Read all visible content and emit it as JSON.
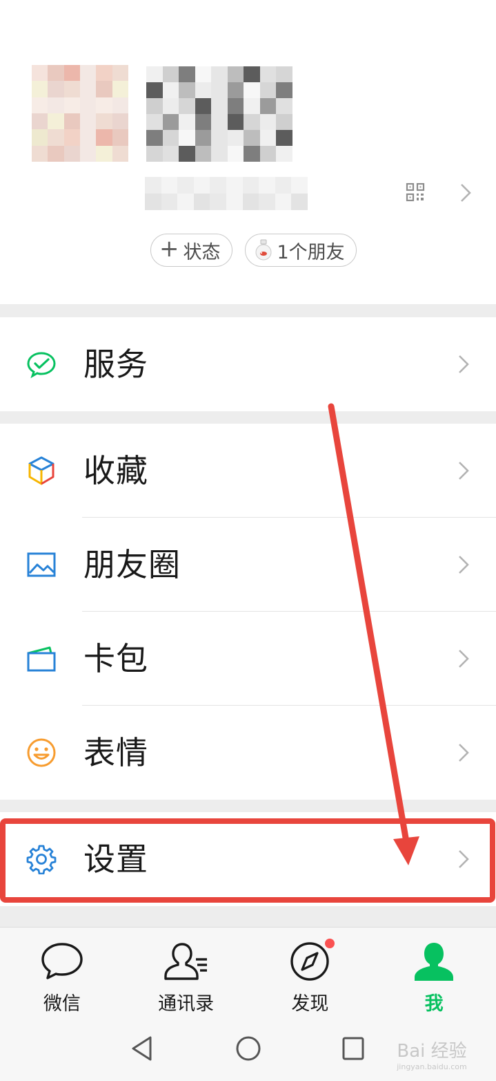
{
  "profile": {
    "status_chip": {
      "plus": "+",
      "label": "状态"
    },
    "friends_chip": {
      "label": "1个朋友"
    },
    "qr_icon": "qr-code-icon"
  },
  "groups": [
    {
      "items": [
        {
          "label": "服务",
          "icon": "wechat-pay-icon",
          "color": "#07c160"
        }
      ]
    },
    {
      "items": [
        {
          "label": "收藏",
          "icon": "cube-icon",
          "color": "#f7b500"
        },
        {
          "label": "朋友圈",
          "icon": "image-icon",
          "color": "#2782d7"
        },
        {
          "label": "卡包",
          "icon": "card-icon",
          "color": "#2782d7"
        },
        {
          "label": "表情",
          "icon": "smile-icon",
          "color": "#f79c2f"
        }
      ]
    },
    {
      "items": [
        {
          "label": "设置",
          "icon": "gear-icon",
          "color": "#2782d7"
        }
      ]
    }
  ],
  "tabbar": {
    "tabs": [
      {
        "label": "微信",
        "icon": "chat-bubble-icon"
      },
      {
        "label": "通讯录",
        "icon": "contacts-icon"
      },
      {
        "label": "发现",
        "icon": "compass-icon",
        "badge": "dot"
      },
      {
        "label": "我",
        "icon": "person-icon",
        "active": true
      }
    ],
    "active_color": "#07c160"
  },
  "watermark": {
    "main": "Bai 经验",
    "sub": "jingyan.baidu.com"
  },
  "colors": {
    "highlight": "#e8453c",
    "badge": "#fa5151"
  }
}
